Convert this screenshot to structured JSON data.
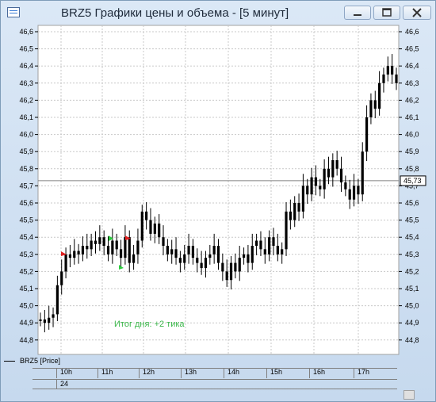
{
  "window": {
    "title": "BRZ5 Графики цены и объема - [5 минут]",
    "buttons": {
      "minimize": "minimize-icon",
      "maximize": "maximize-icon",
      "close": "close-icon"
    }
  },
  "chart": {
    "current_price_label": "45,73",
    "note": "Итог дня: +2 тика",
    "legend": "BRZ5 [Price]",
    "x_labels": [
      "10h",
      "11h",
      "12h",
      "13h",
      "14h",
      "15h",
      "16h",
      "17h"
    ],
    "day_label": "24"
  },
  "chart_data": {
    "type": "candlestick",
    "ylim": [
      44.75,
      46.63
    ],
    "y_ticks": [
      "44,8",
      "44,9",
      "45,0",
      "45,1",
      "45,2",
      "45,3",
      "45,4",
      "45,5",
      "45,6",
      "45,7",
      "45,8",
      "45,9",
      "46,0",
      "46,1",
      "46,2",
      "46,3",
      "46,4",
      "46,5",
      "46,6"
    ],
    "current_price": 45.73,
    "x_categories": [
      "10h",
      "11h",
      "12h",
      "13h",
      "14h",
      "15h",
      "16h",
      "17h"
    ],
    "colors": {
      "candle": "#000000",
      "price_line": "#808080",
      "grid": "#c8c8c8",
      "note": "#3db84c",
      "buy_marker": "#2ecc40",
      "sell_marker": "#e02020"
    },
    "close_series": [
      44.92,
      44.9,
      44.93,
      44.95,
      45.12,
      45.2,
      45.3,
      45.28,
      45.32,
      45.3,
      45.35,
      45.33,
      45.38,
      45.36,
      45.4,
      45.35,
      45.3,
      45.38,
      45.33,
      45.28,
      45.4,
      45.25,
      45.3,
      45.38,
      45.55,
      45.5,
      45.42,
      45.48,
      45.4,
      45.35,
      45.3,
      45.33,
      45.28,
      45.25,
      45.3,
      45.35,
      45.28,
      45.25,
      45.22,
      45.28,
      45.3,
      45.35,
      45.25,
      45.2,
      45.15,
      45.25,
      45.2,
      45.28,
      45.3,
      45.25,
      45.35,
      45.38,
      45.33,
      45.3,
      45.4,
      45.35,
      45.3,
      45.33,
      45.55,
      45.5,
      45.6,
      45.55,
      45.7,
      45.65,
      45.75,
      45.7,
      45.68,
      45.8,
      45.75,
      45.85,
      45.8,
      45.72,
      45.68,
      45.62,
      45.7,
      45.65,
      45.9,
      46.1,
      46.2,
      46.15,
      46.3,
      46.35,
      46.4,
      46.35,
      46.3
    ]
  }
}
